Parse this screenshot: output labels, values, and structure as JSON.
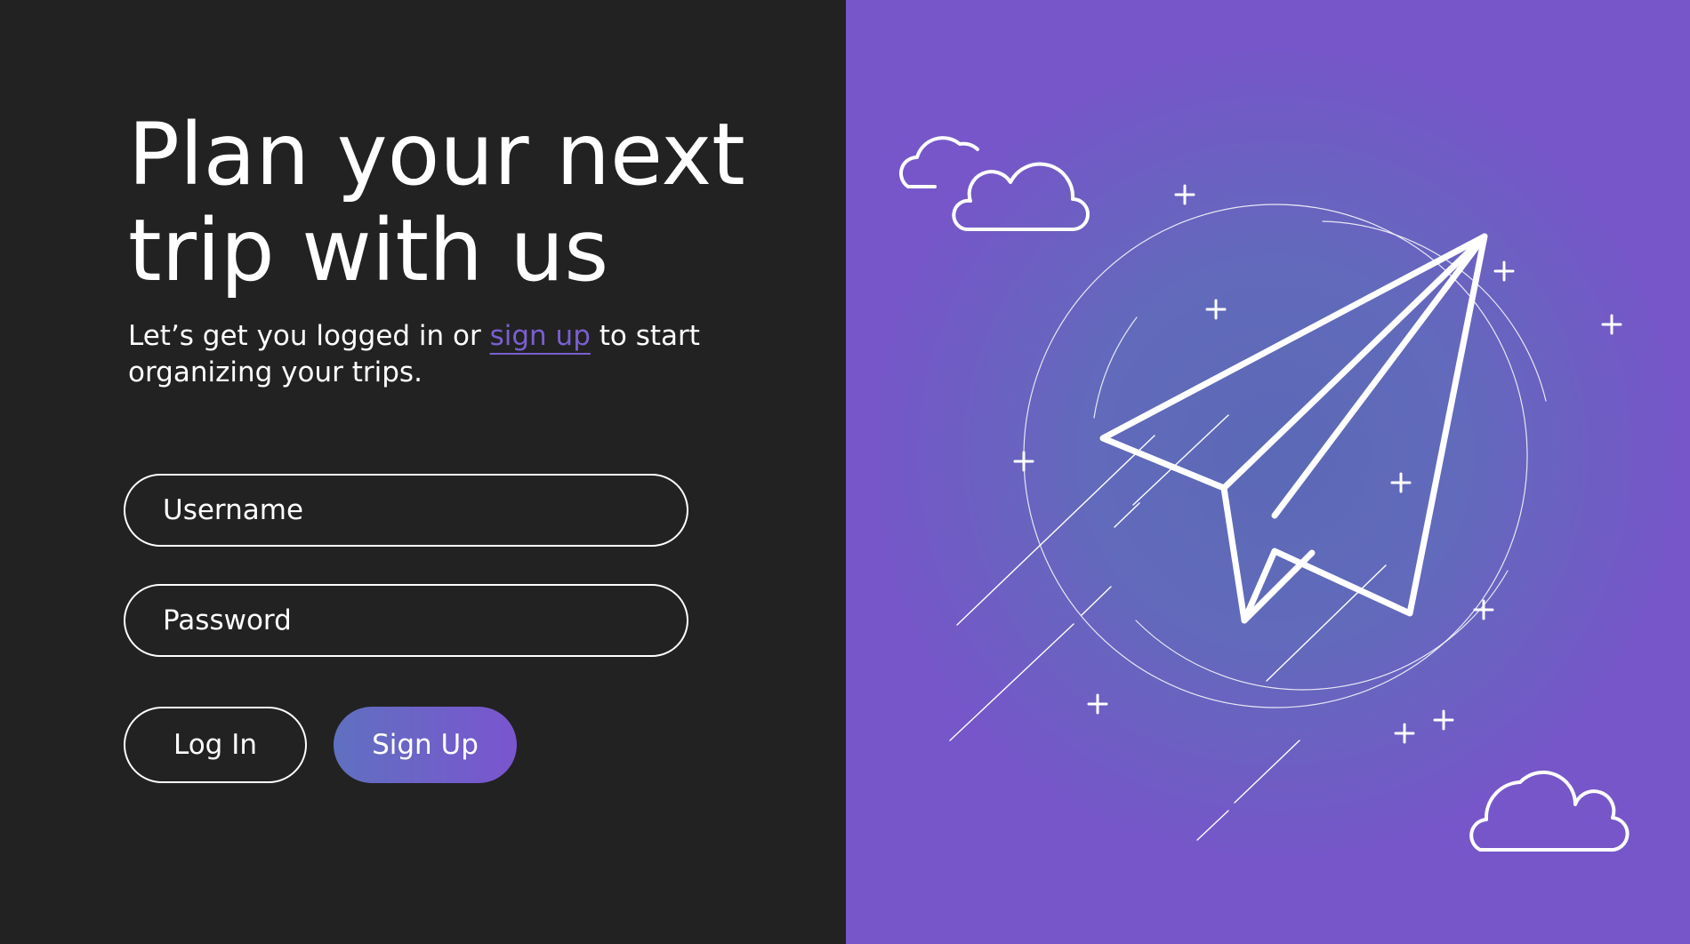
{
  "hero": {
    "title_line1": "Plan your next",
    "title_line2": "trip with us",
    "subtitle_before": "Let’s get you logged in or ",
    "subtitle_link": "sign up",
    "subtitle_after": " to start organizing your trips."
  },
  "form": {
    "username_placeholder": "Username",
    "password_placeholder": "Password",
    "login_label": "Log In",
    "signup_label": "Sign Up"
  },
  "theme": {
    "dark_background": "#222222",
    "accent_purple": "#7656c9",
    "link_purple": "#7a5fd0",
    "illustration_blue": "#5b69b6"
  },
  "illustration": {
    "icons": [
      "paper-plane-icon",
      "cloud-icon",
      "sparkle-icon"
    ]
  }
}
